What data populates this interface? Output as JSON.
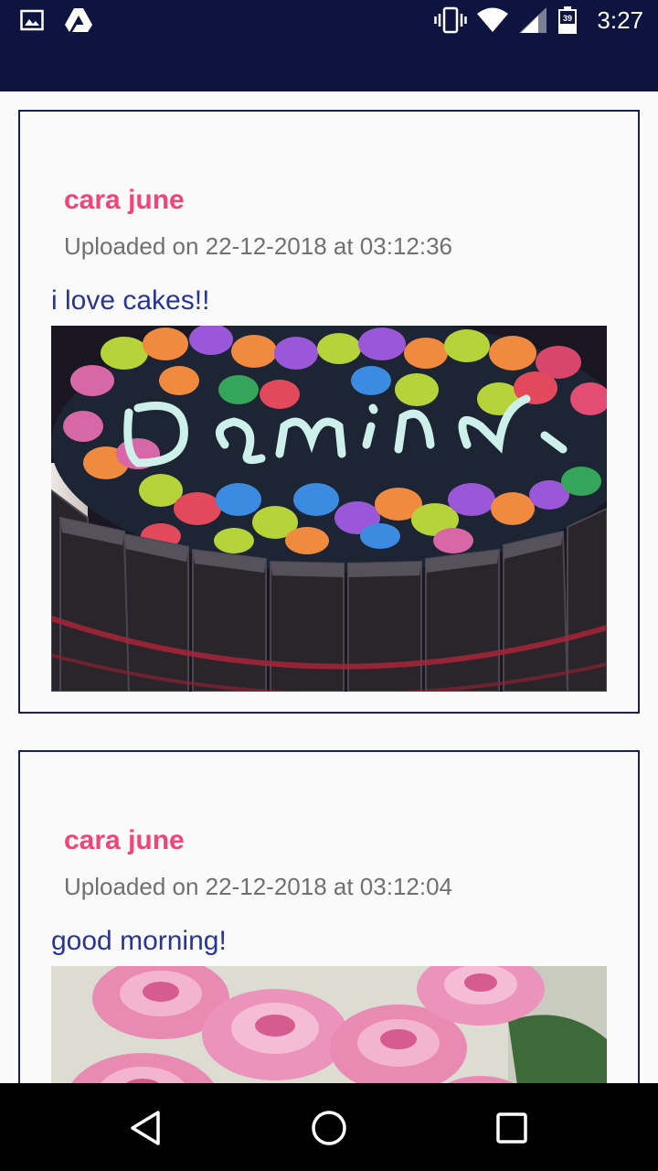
{
  "status_bar": {
    "time": "3:27",
    "battery_level": "39",
    "icons": [
      "image-icon",
      "drive-icon",
      "vibrate-icon",
      "wifi-icon",
      "signal-icon",
      "battery-icon"
    ]
  },
  "feed": {
    "posts": [
      {
        "author": "cara june",
        "uploaded": "Uploaded on 22-12-2018 at 03:12:36",
        "caption": "i love cakes!!",
        "image": "cake-photo"
      },
      {
        "author": "cara june",
        "uploaded": "Uploaded on 22-12-2018 at 03:12:04",
        "caption": "good morning!",
        "image": "roses-photo"
      }
    ]
  },
  "nav_bar": {
    "icons": [
      "back-icon",
      "home-icon",
      "recents-icon"
    ]
  },
  "colors": {
    "app_bar": "#0d1440",
    "author": "#f0447a",
    "caption": "#283593",
    "card_border": "#1b2050"
  }
}
